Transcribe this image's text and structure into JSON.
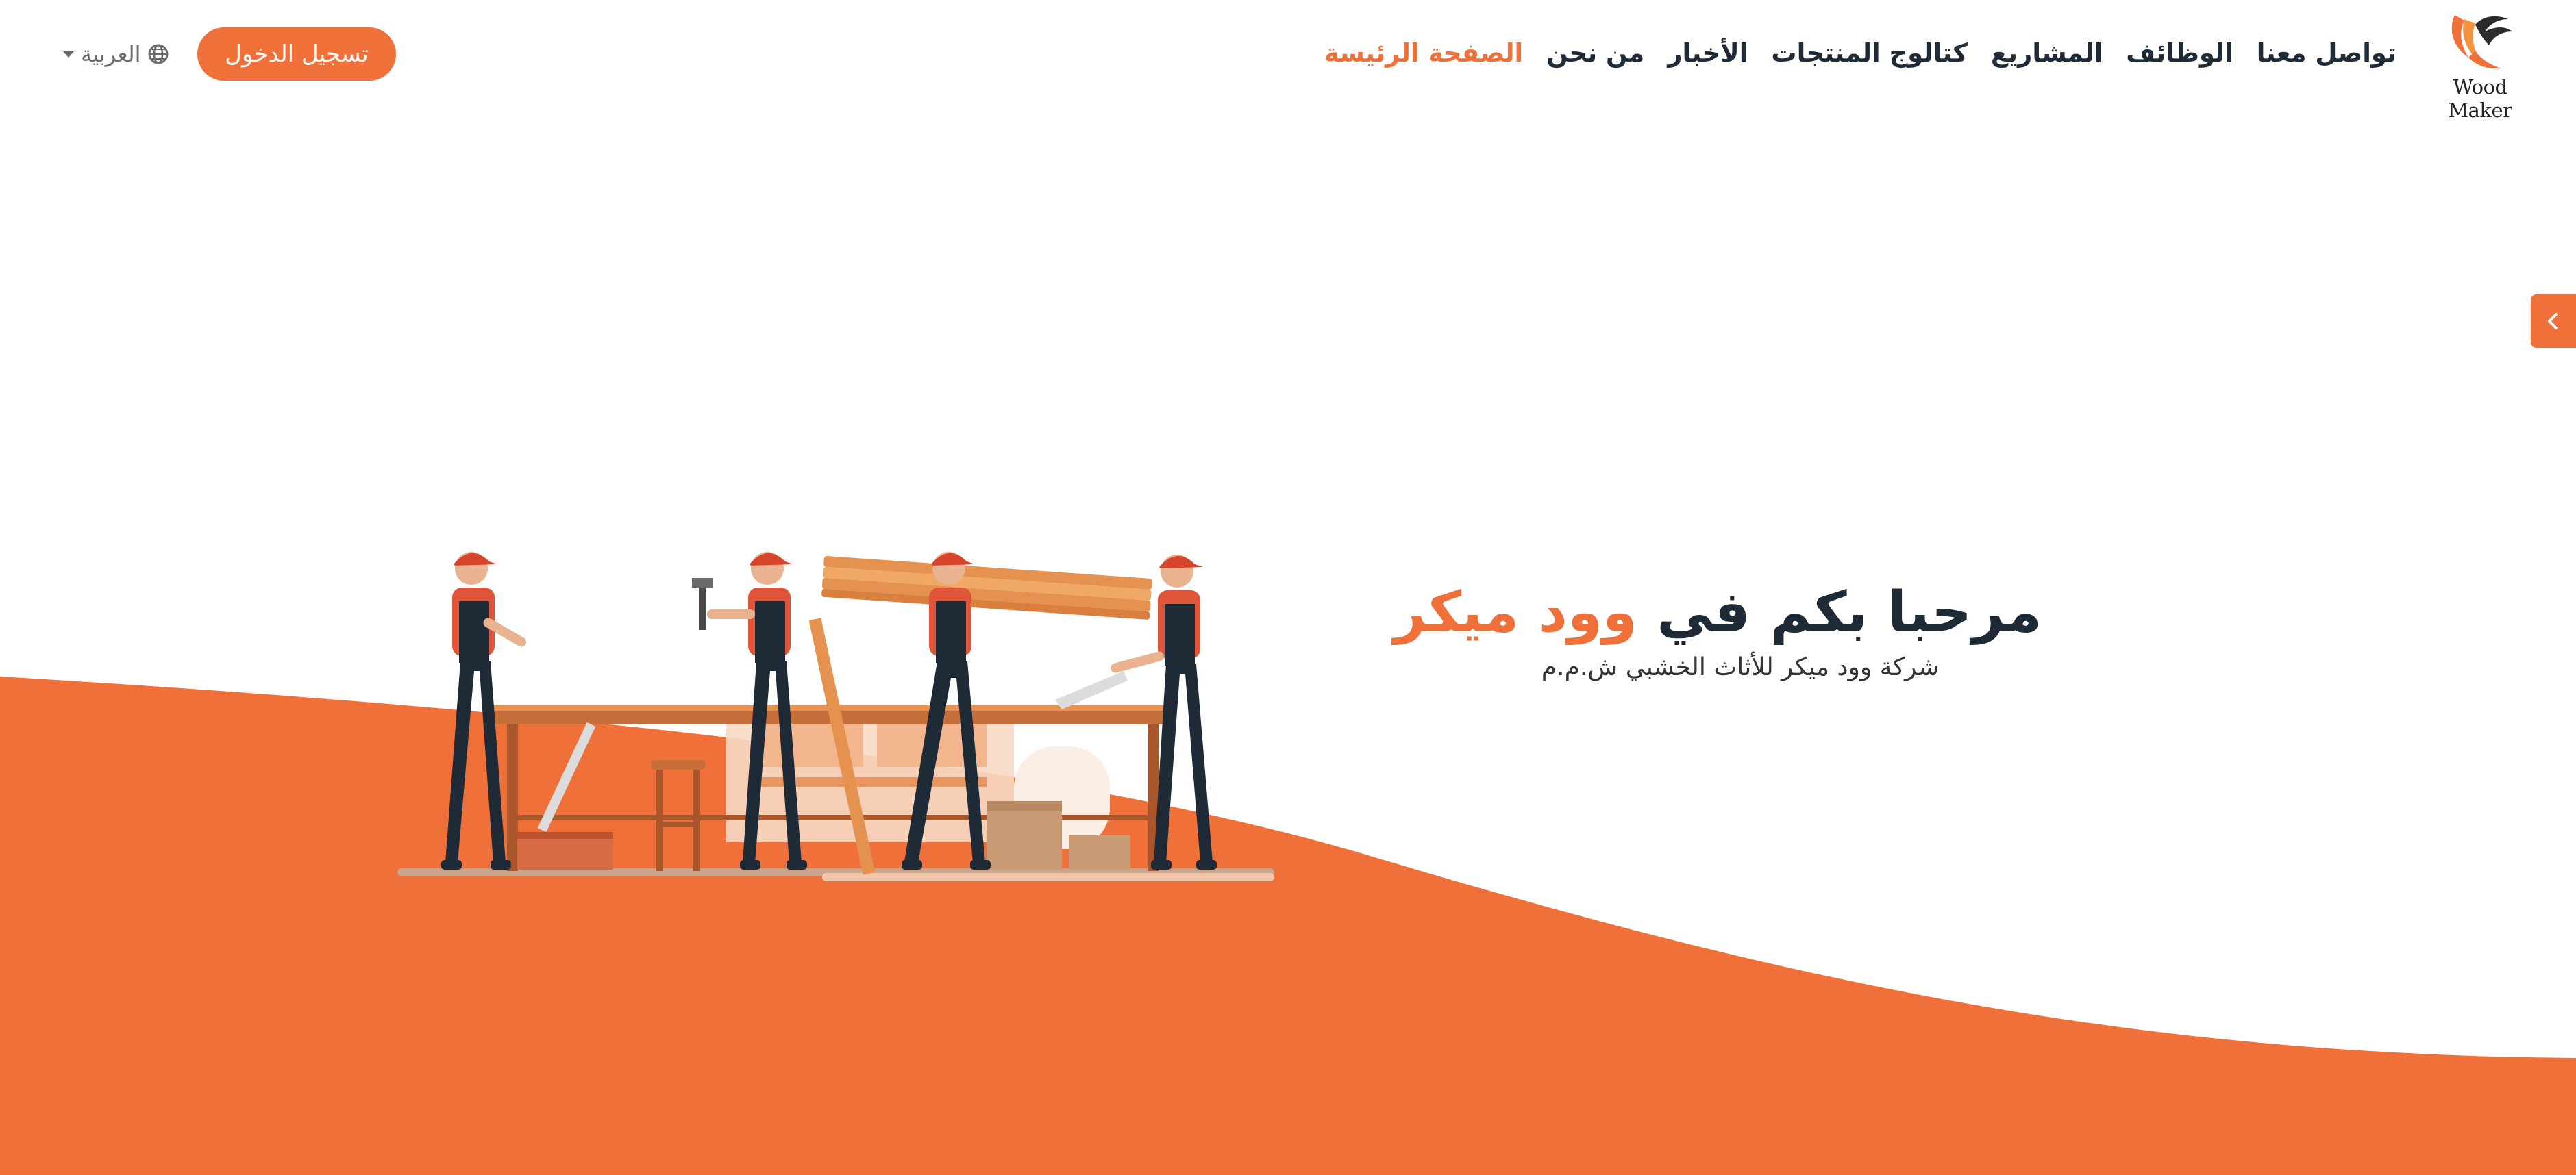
{
  "brand": {
    "logo_text": "Wood Maker",
    "accent_color": "#f07039",
    "dark_color": "#1f2a37"
  },
  "nav": {
    "items": [
      {
        "label": "الصفحة الرئيسة",
        "active": true
      },
      {
        "label": "من نحن"
      },
      {
        "label": "الأخبار"
      },
      {
        "label": "كتالوج المنتجات"
      },
      {
        "label": "المشاريع"
      },
      {
        "label": "الوظائف"
      },
      {
        "label": "تواصل معنا"
      }
    ]
  },
  "header": {
    "login_label": "تسجيل الدخول",
    "language_label": "العربية",
    "language_icon": "globe-icon"
  },
  "side_tab": {
    "icon": "chevron-left-icon"
  },
  "hero": {
    "title_prefix": "مرحبا بكم في ",
    "title_brand": "وود ميكر",
    "subtitle": "شركة وود ميكر للأثاث الخشبي ش.م.م",
    "illustration": "carpenters-workshop-illustration"
  }
}
